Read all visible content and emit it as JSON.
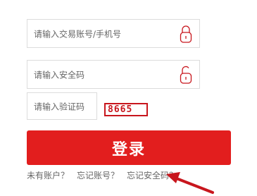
{
  "form": {
    "account": {
      "placeholder": "请输入交易账号/手机号",
      "icon": "lock-closed-icon"
    },
    "password": {
      "placeholder": "请输入安全码",
      "icon": "lock-open-icon"
    },
    "captcha": {
      "placeholder": "请输入验证码",
      "code": "8665"
    },
    "submit_label": "登录"
  },
  "links": {
    "no_account": "未有账户？",
    "forgot_account": "忘记账号？",
    "forgot_security_code": "忘记安全码？"
  },
  "colors": {
    "accent": "#e21e1e",
    "captcha_border": "#c8161d",
    "field_border": "#dcdcdc",
    "text_muted": "#666666",
    "arrow": "#c8161d"
  }
}
